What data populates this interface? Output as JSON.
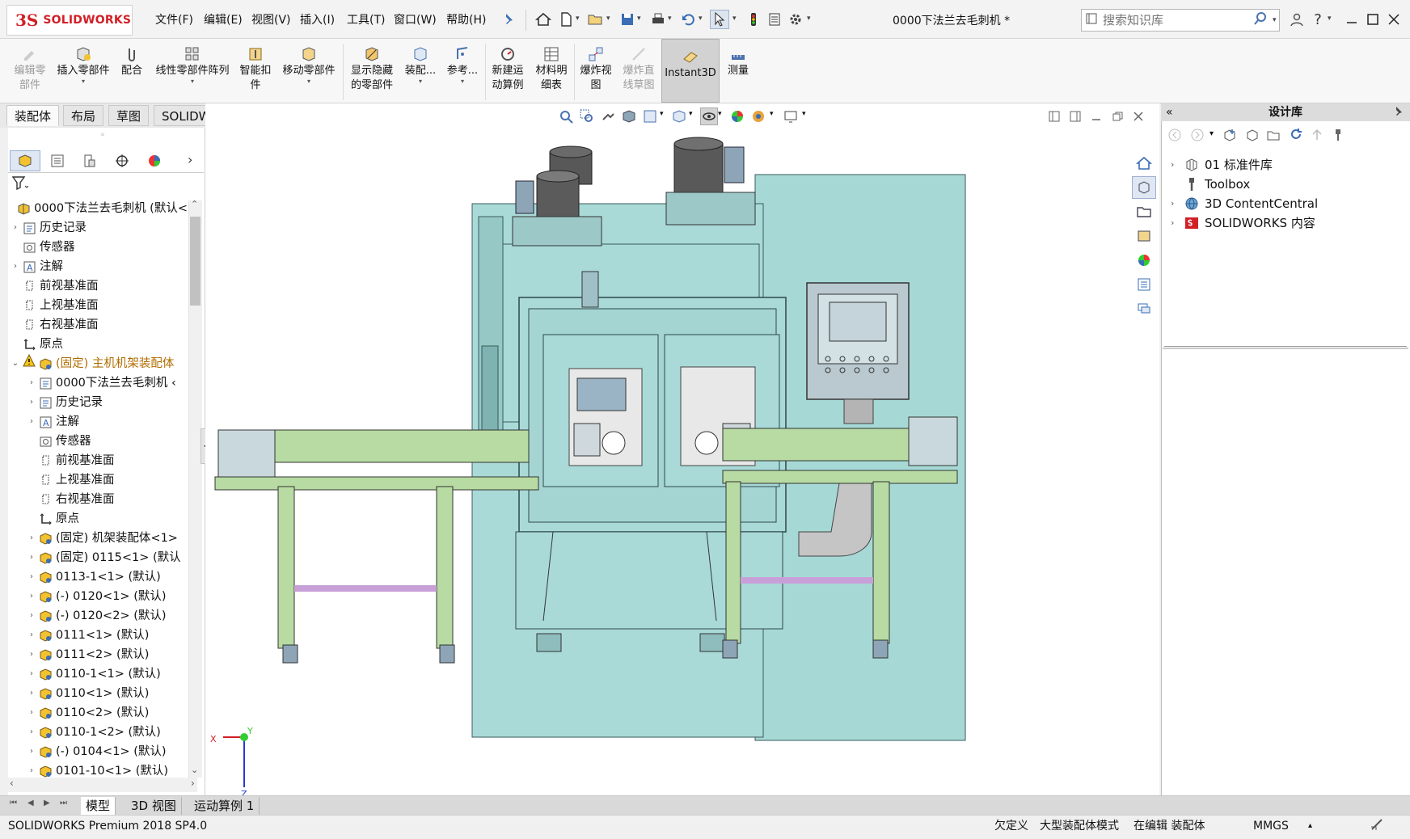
{
  "app": {
    "brand_mark": "3S",
    "brand_text": "SOLIDWORKS",
    "doc_title": "0000下法兰去毛刺机 *"
  },
  "menu": [
    "文件(F)",
    "编辑(E)",
    "视图(V)",
    "插入(I)",
    "工具(T)",
    "窗口(W)",
    "帮助(H)"
  ],
  "search": {
    "placeholder": "搜索知识库"
  },
  "commands": [
    {
      "label": "编辑零\n部件",
      "enabled": false
    },
    {
      "label": "插入零部件",
      "enabled": true
    },
    {
      "label": "配合",
      "enabled": true
    },
    {
      "label": "线性零部件阵列",
      "enabled": true
    },
    {
      "label": "智能扣\n件",
      "enabled": true
    },
    {
      "label": "移动零部件",
      "enabled": true
    },
    {
      "label": "显示隐藏\n的零部件",
      "enabled": true
    },
    {
      "label": "装配...",
      "enabled": true
    },
    {
      "label": "参考...",
      "enabled": true
    },
    {
      "label": "新建运\n动算例",
      "enabled": true
    },
    {
      "label": "材料明\n细表",
      "enabled": true
    },
    {
      "label": "爆炸视\n图",
      "enabled": true
    },
    {
      "label": "爆炸直\n线草图",
      "enabled": false
    },
    {
      "label": "Instant3D",
      "enabled": true,
      "active": true
    },
    {
      "label": "测量",
      "enabled": true
    }
  ],
  "cm_tabs": [
    "装配体",
    "布局",
    "草图",
    "SOLIDWORKS MBD"
  ],
  "tree": [
    {
      "label": "0000下法兰去毛刺机 (默认<",
      "level": 0,
      "expand": "",
      "icon": "assembly"
    },
    {
      "label": "历史记录",
      "level": 0,
      "expand": "›",
      "icon": "history"
    },
    {
      "label": "传感器",
      "level": 0,
      "expand": "",
      "icon": "sensor"
    },
    {
      "label": "注解",
      "level": 0,
      "expand": "›",
      "icon": "annotation"
    },
    {
      "label": "前视基准面",
      "level": 0,
      "expand": "",
      "icon": "plane"
    },
    {
      "label": "上视基准面",
      "level": 0,
      "expand": "",
      "icon": "plane"
    },
    {
      "label": "右视基准面",
      "level": 0,
      "expand": "",
      "icon": "plane"
    },
    {
      "label": "原点",
      "level": 0,
      "expand": "",
      "icon": "origin"
    },
    {
      "label": "(固定) 主机机架装配体",
      "level": 0,
      "expand": "⌄",
      "icon": "subassembly",
      "warn": true
    },
    {
      "label": "0000下法兰去毛刺机 ‹",
      "level": 1,
      "expand": "›",
      "icon": "history"
    },
    {
      "label": "历史记录",
      "level": 1,
      "expand": "›",
      "icon": "history"
    },
    {
      "label": "注解",
      "level": 1,
      "expand": "›",
      "icon": "annotation"
    },
    {
      "label": "传感器",
      "level": 1,
      "expand": "",
      "icon": "sensor"
    },
    {
      "label": "前视基准面",
      "level": 1,
      "expand": "",
      "icon": "plane"
    },
    {
      "label": "上视基准面",
      "level": 1,
      "expand": "",
      "icon": "plane"
    },
    {
      "label": "右视基准面",
      "level": 1,
      "expand": "",
      "icon": "plane"
    },
    {
      "label": "原点",
      "level": 1,
      "expand": "",
      "icon": "origin"
    },
    {
      "label": "(固定) 机架装配体<1>",
      "level": 1,
      "expand": "›",
      "icon": "subassembly"
    },
    {
      "label": "(固定) 0115<1> (默认",
      "level": 1,
      "expand": "›",
      "icon": "subassembly"
    },
    {
      "label": "0113-1<1> (默认)",
      "level": 1,
      "expand": "›",
      "icon": "subassembly"
    },
    {
      "label": "(-) 0120<1> (默认)",
      "level": 1,
      "expand": "›",
      "icon": "subassembly"
    },
    {
      "label": "(-) 0120<2> (默认)",
      "level": 1,
      "expand": "›",
      "icon": "subassembly"
    },
    {
      "label": "0111<1> (默认)",
      "level": 1,
      "expand": "›",
      "icon": "subassembly"
    },
    {
      "label": "0111<2> (默认)",
      "level": 1,
      "expand": "›",
      "icon": "subassembly"
    },
    {
      "label": "0110-1<1> (默认)",
      "level": 1,
      "expand": "›",
      "icon": "subassembly"
    },
    {
      "label": "0110<1> (默认)",
      "level": 1,
      "expand": "›",
      "icon": "subassembly"
    },
    {
      "label": "0110<2> (默认)",
      "level": 1,
      "expand": "›",
      "icon": "subassembly"
    },
    {
      "label": "0110-1<2> (默认)",
      "level": 1,
      "expand": "›",
      "icon": "subassembly"
    },
    {
      "label": "(-) 0104<1> (默认)",
      "level": 1,
      "expand": "›",
      "icon": "subassembly"
    },
    {
      "label": "0101-10<1> (默认)",
      "level": 1,
      "expand": "›",
      "icon": "subassembly"
    }
  ],
  "bottom_tabs": [
    "模型",
    "3D 视图",
    "运动算例 1"
  ],
  "status": {
    "product": "SOLIDWORKS Premium 2018 SP4.0",
    "defined": "欠定义",
    "large_mode": "大型装配体模式",
    "editing": "在编辑 装配体",
    "units": "MMGS",
    "units_arrow": "▴"
  },
  "taskpane": {
    "title": "设计库",
    "items": [
      {
        "label": "01 标准件库",
        "expand": "›",
        "icon": "library-folder-icon"
      },
      {
        "label": "Toolbox",
        "expand": "",
        "icon": "toolbox-icon"
      },
      {
        "label": "3D ContentCentral",
        "expand": "›",
        "icon": "globe-icon"
      },
      {
        "label": "SOLIDWORKS 内容",
        "expand": "›",
        "icon": "sw-content-icon"
      }
    ]
  },
  "triad": {
    "x_label": "X",
    "y_label": "Y",
    "z_label": "Z"
  },
  "colors": {
    "machine": "#a9dad8",
    "frame": "#b7dba2",
    "accent_red": "#d21f26",
    "purple": "#c8a0d8"
  }
}
